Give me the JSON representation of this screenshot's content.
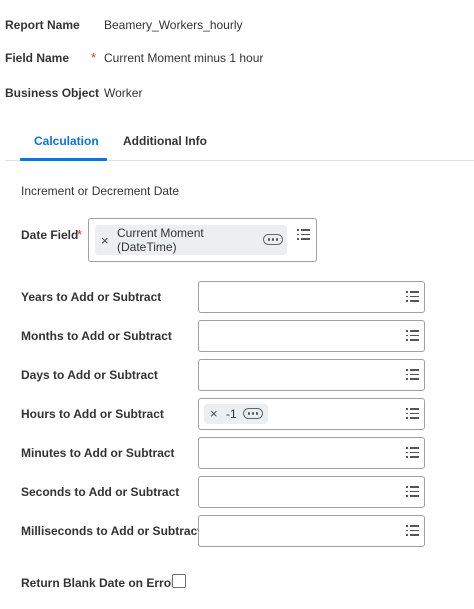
{
  "header": {
    "report_name_label": "Report Name",
    "report_name_value": "Beamery_Workers_hourly",
    "field_name_label": "Field Name",
    "field_name_required": "*",
    "field_name_value": "Current Moment minus 1 hour",
    "business_object_label": "Business Object",
    "business_object_value": "Worker"
  },
  "tabs": [
    {
      "label": "Calculation",
      "active": true
    },
    {
      "label": "Additional Info",
      "active": false
    }
  ],
  "section_title": "Increment or Decrement Date",
  "date_field": {
    "label": "Date Field",
    "required": "*",
    "pill_remove": "×",
    "pill_line1": "Current Moment",
    "pill_line2": "(DateTime)"
  },
  "rows": [
    {
      "label": "Years to Add or Subtract",
      "value": ""
    },
    {
      "label": "Months to Add or Subtract",
      "value": ""
    },
    {
      "label": "Days to Add or Subtract",
      "value": ""
    },
    {
      "label": "Hours to Add or Subtract",
      "value": "-1",
      "pill_remove": "×"
    },
    {
      "label": "Minutes to Add or Subtract",
      "value": ""
    },
    {
      "label": "Seconds to Add or Subtract",
      "value": ""
    },
    {
      "label": "Milliseconds to Add or Subtract",
      "value": ""
    }
  ],
  "return_blank": {
    "label": "Return Blank Date on Error",
    "checked": false
  },
  "colors": {
    "accent": "#0875e1",
    "required": "#d93025",
    "border": "#a0a0a0",
    "pill_bg": "#eceff1"
  },
  "icons": {
    "prompt": "list-icon",
    "more": "more-icon",
    "remove": "close-icon"
  }
}
